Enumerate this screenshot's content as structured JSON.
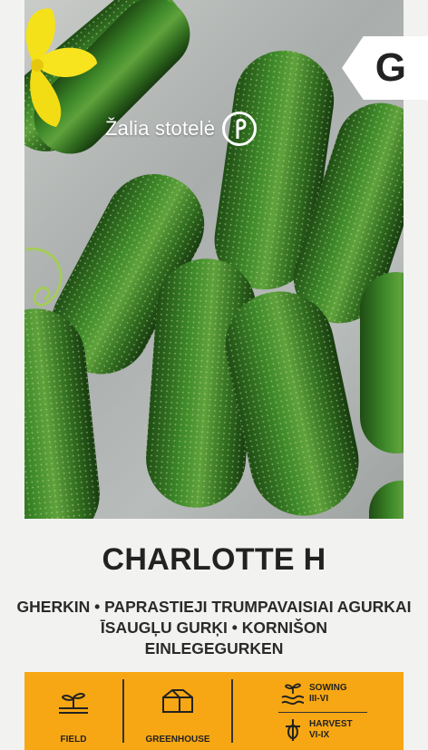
{
  "brand": {
    "name": "Žalia stotelė"
  },
  "badge": {
    "letter": "G"
  },
  "product": {
    "title": "CHARLOTTE H",
    "subtitle_lines": [
      "GHERKIN • PAPRASTIEJI TRUMPAVAISIAI AGURKAI",
      "ĪSAUGĻU GURĶI • KORNIŠON",
      "EINLEGEGURKEN"
    ]
  },
  "info": {
    "field_label": "FIELD",
    "greenhouse_label": "GREENHOUSE",
    "sowing_label": "SOWING",
    "sowing_period": "III-VI",
    "harvest_label": "HARVEST",
    "harvest_period": "VI-IX"
  },
  "icons": {
    "field": "field-sprout-icon",
    "greenhouse": "greenhouse-icon",
    "sowing": "sowing-icon",
    "harvest": "harvest-icon",
    "logo": "brand-leaf-logo-icon"
  },
  "colors": {
    "panel": "#f7a713",
    "cucumber": "#2e6b1f",
    "flower": "#f5e11a"
  }
}
